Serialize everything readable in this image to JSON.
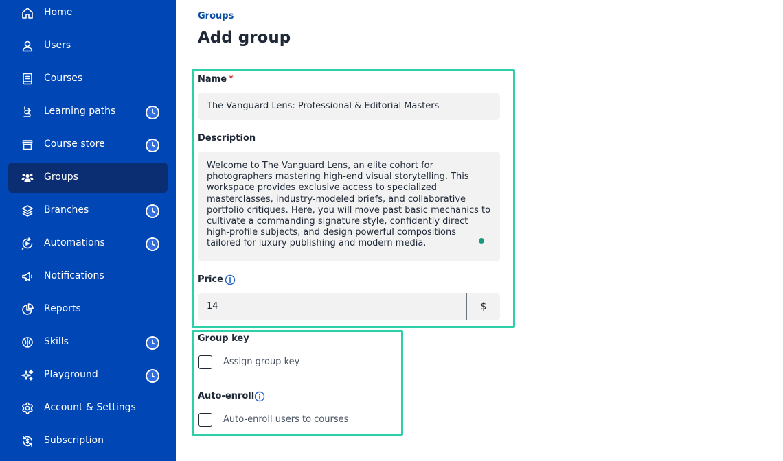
{
  "sidebar": {
    "items": [
      {
        "label": "Home",
        "icon": "home-icon"
      },
      {
        "label": "Users",
        "icon": "user-icon"
      },
      {
        "label": "Courses",
        "icon": "book-icon"
      },
      {
        "label": "Learning paths",
        "icon": "path-icon",
        "badge": "clock-icon"
      },
      {
        "label": "Course store",
        "icon": "store-icon",
        "badge": "clock-icon"
      },
      {
        "label": "Groups",
        "icon": "groups-icon",
        "active": true
      },
      {
        "label": "Branches",
        "icon": "layers-icon",
        "badge": "clock-icon"
      },
      {
        "label": "Automations",
        "icon": "automation-icon",
        "badge": "clock-icon"
      },
      {
        "label": "Notifications",
        "icon": "megaphone-icon"
      },
      {
        "label": "Reports",
        "icon": "pie-chart-icon"
      },
      {
        "label": "Skills",
        "icon": "skills-icon",
        "badge": "clock-icon"
      },
      {
        "label": "Playground",
        "icon": "sparkle-icon",
        "badge": "clock-icon"
      },
      {
        "label": "Account & Settings",
        "icon": "gear-icon"
      },
      {
        "label": "Subscription",
        "icon": "subscription-icon"
      }
    ]
  },
  "breadcrumb": "Groups",
  "page_title": "Add group",
  "form": {
    "name_label": "Name",
    "name_required_mark": "*",
    "name_value": "The Vanguard Lens: Professional & Editorial Masters",
    "description_label": "Description",
    "description_value": "Welcome to The Vanguard Lens, an elite cohort for photographers mastering high-end visual storytelling. This workspace provides exclusive access to specialized masterclasses, industry-modeled briefs, and collaborative portfolio critiques. Here, you will move past basic mechanics to cultivate a commanding signature style, confidently direct high-profile subjects, and design powerful compositions tailored for luxury publishing and modern media.",
    "price_label": "Price",
    "price_value": "14",
    "price_currency": "$",
    "group_key_label": "Group key",
    "assign_group_key_label": "Assign group key",
    "auto_enroll_label": "Auto-enroll",
    "auto_enroll_option_label": "Auto-enroll users to courses"
  },
  "colors": {
    "sidebar_bg": "#0046b4",
    "sidebar_active": "#0b2e73",
    "highlight": "#2ccfa8",
    "link": "#0b4ea2"
  }
}
